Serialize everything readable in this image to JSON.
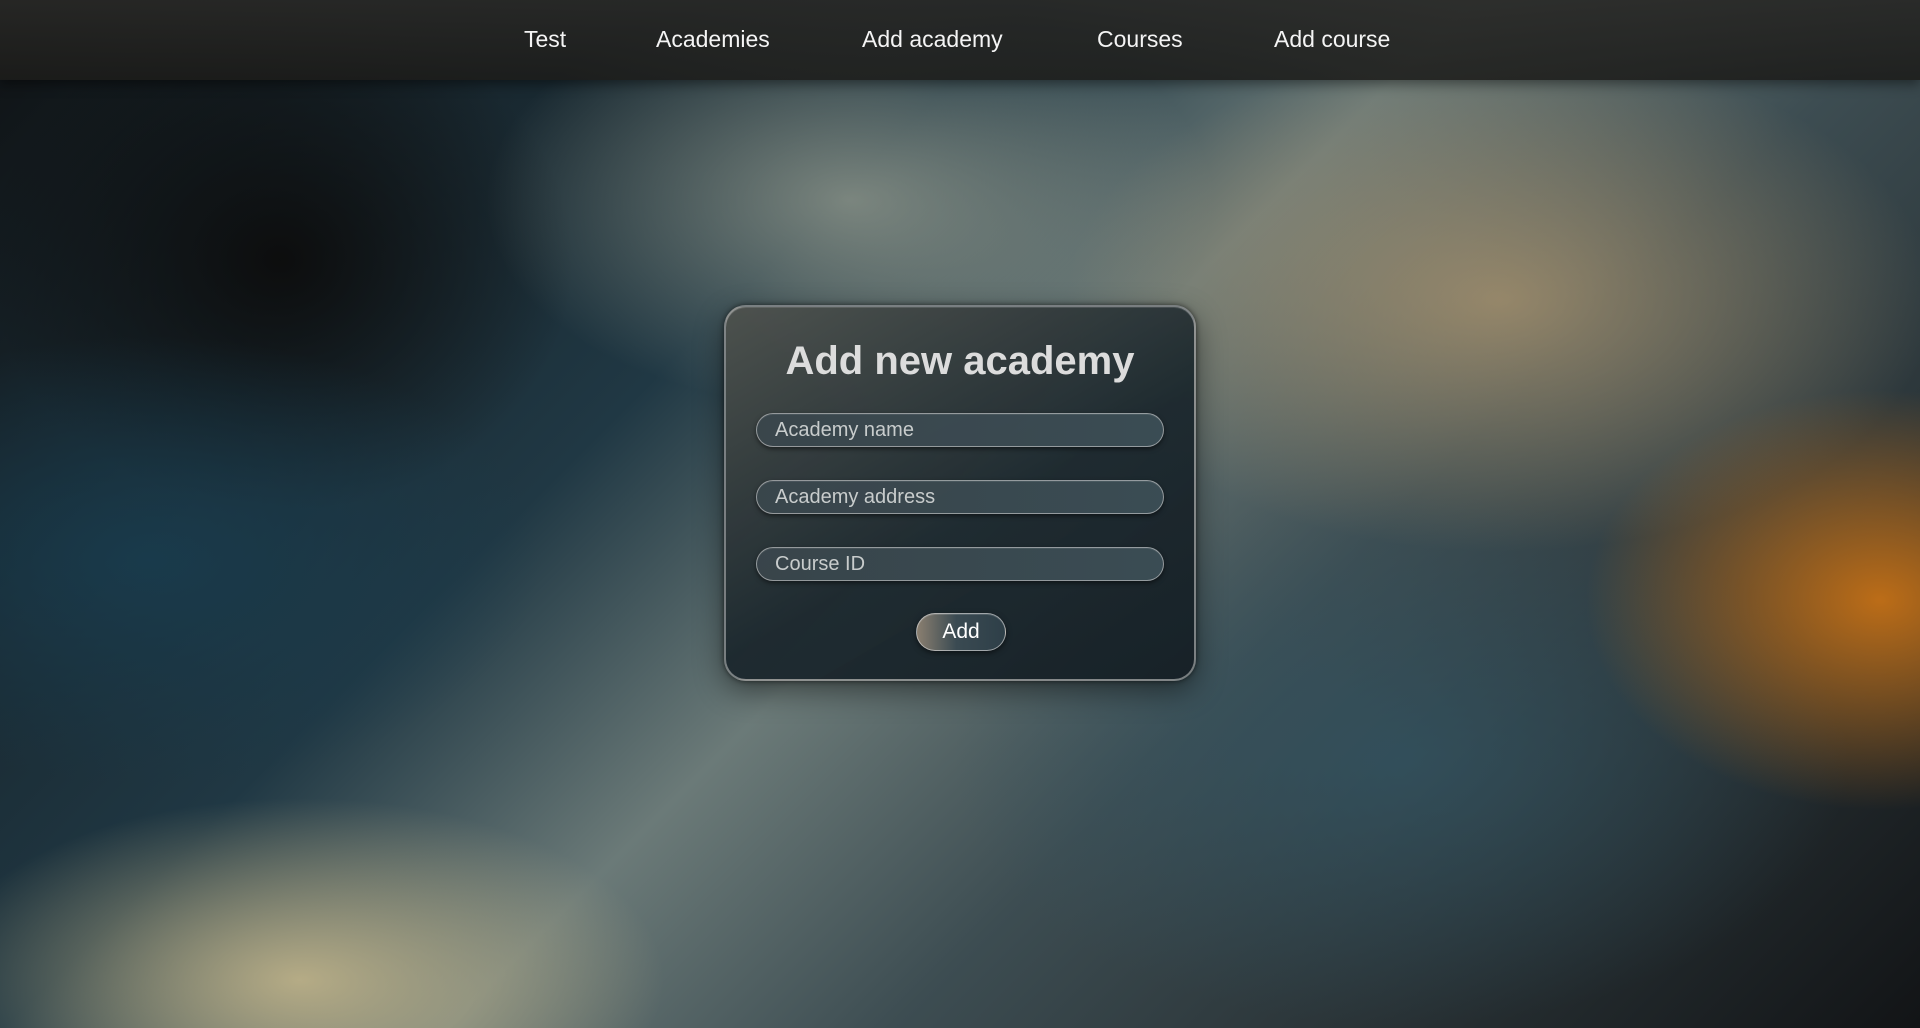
{
  "nav": {
    "items": [
      {
        "label": "Test"
      },
      {
        "label": "Academies"
      },
      {
        "label": "Add academy"
      },
      {
        "label": "Courses"
      },
      {
        "label": "Add course"
      }
    ]
  },
  "form": {
    "title": "Add new academy",
    "fields": [
      {
        "placeholder": "Academy name",
        "value": ""
      },
      {
        "placeholder": "Academy address",
        "value": ""
      },
      {
        "placeholder": "Course ID",
        "value": ""
      }
    ],
    "submit_label": "Add"
  }
}
